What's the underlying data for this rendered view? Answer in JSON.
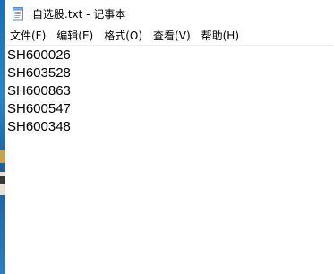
{
  "window": {
    "title": "自选股.txt - 记事本",
    "icon": "notepad-icon"
  },
  "menu": {
    "items": [
      {
        "id": "file",
        "label": "文件(F)"
      },
      {
        "id": "edit",
        "label": "编辑(E)"
      },
      {
        "id": "format",
        "label": "格式(O)"
      },
      {
        "id": "view",
        "label": "查看(V)"
      },
      {
        "id": "help",
        "label": "帮助(H)"
      }
    ]
  },
  "document": {
    "lines": [
      "SH600026",
      "SH603528",
      "SH600863",
      "SH600547",
      "SH600348"
    ]
  },
  "colors": {
    "background": "#ffffff",
    "text": "#000000",
    "desktop": "#1a6fb5"
  }
}
